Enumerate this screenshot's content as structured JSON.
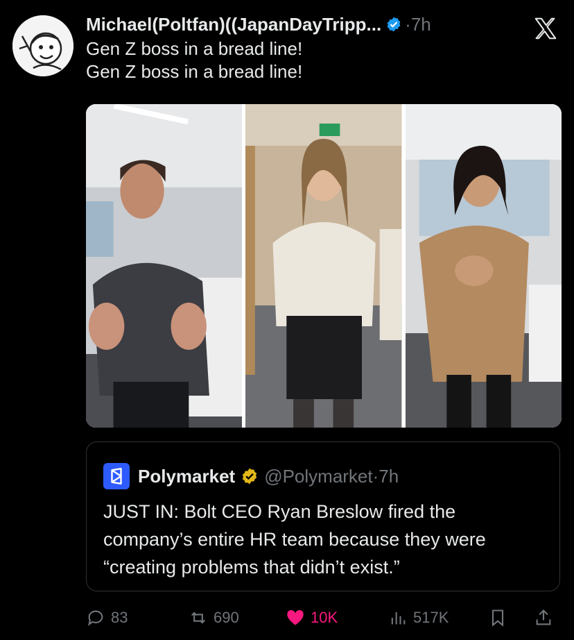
{
  "tweet": {
    "author_name": "Michael(Poltfan)((JapanDayTripp...",
    "time": "7h",
    "separator": "·",
    "lines": [
      "Gen Z boss in a bread line!",
      "Gen Z boss in a bread line!"
    ]
  },
  "quote": {
    "name": "Polymarket",
    "handle": "@Polymarket",
    "time": "7h",
    "separator": "·",
    "text": "JUST IN: Bolt CEO Ryan Breslow fired the company’s entire HR team because they were “creating problems that didn’t exist.”"
  },
  "actions": {
    "replies": "83",
    "reposts": "690",
    "likes": "10K",
    "views": "517K"
  },
  "colors": {
    "background": "#000000",
    "text": "#e7e9ea",
    "muted": "#71767b",
    "verified_blue": "#1d9bf0",
    "verified_gold": "#e2b719",
    "like_pink": "#f91880",
    "polymarket_blue": "#2e5bff"
  },
  "icons": [
    "avatar-cartoon",
    "verified-badge-icon",
    "x-logo-icon",
    "polymarket-logo-icon",
    "gold-verified-badge-icon",
    "reply-icon",
    "repost-icon",
    "like-heart-icon",
    "views-icon",
    "bookmark-icon",
    "share-icon"
  ]
}
